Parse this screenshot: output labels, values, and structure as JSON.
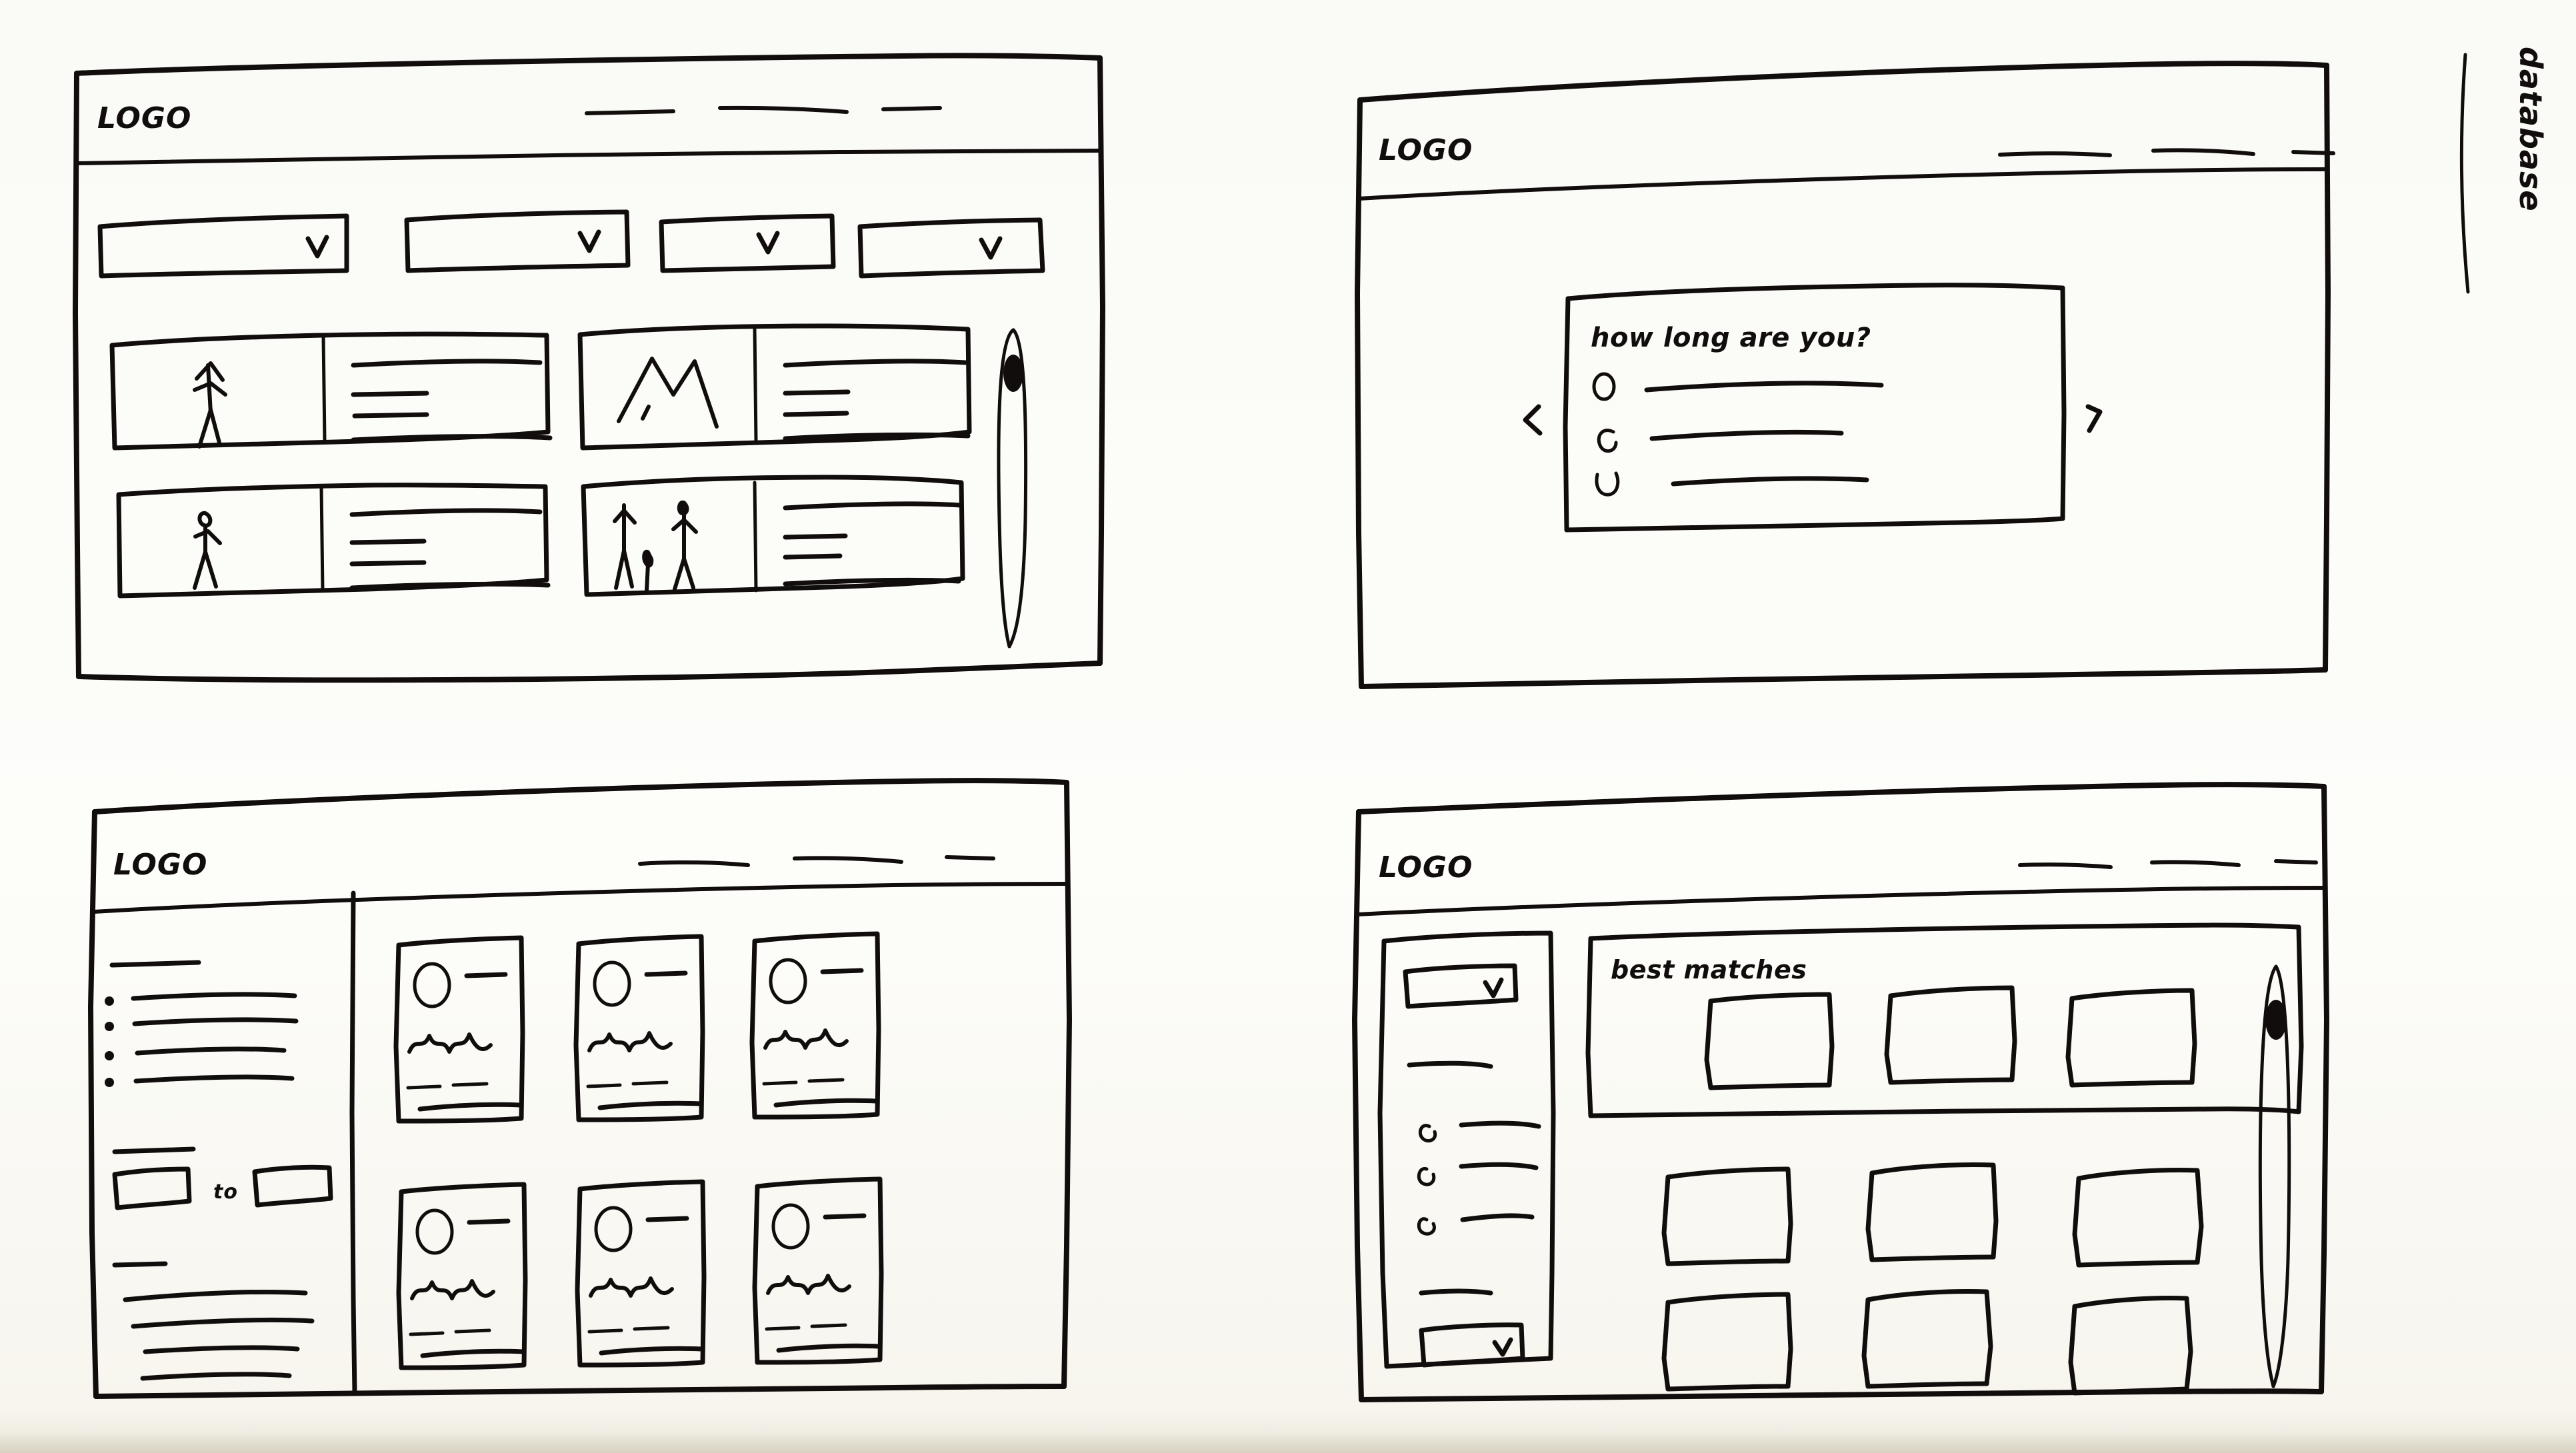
{
  "sketch": {
    "medium": "hand-drawn marker wireframe on paper",
    "ink_color": "#100d0c",
    "paper_color": "#fdfdfb",
    "panel_count": 4
  },
  "annotation": {
    "label": "database",
    "orientation": "vertical",
    "underlined": true
  },
  "panel_browse": {
    "name": "browse-results-screen",
    "logo": "LOGO",
    "nav_links": [
      "—",
      "——",
      "——"
    ],
    "filters": [
      {
        "label": "",
        "chevron": "v"
      },
      {
        "label": "",
        "chevron": "v"
      },
      {
        "label": "",
        "chevron": "v"
      },
      {
        "label": "",
        "chevron": "v"
      }
    ],
    "cards": [
      {
        "thumb": "single-standing-figure",
        "lines": 4
      },
      {
        "thumb": "mountain-peaks",
        "lines": 4
      },
      {
        "thumb": "single-walking-figure",
        "lines": 4
      },
      {
        "thumb": "group-of-figures",
        "lines": 4
      }
    ],
    "scrollbar": {
      "thumb_position": "top"
    }
  },
  "panel_question": {
    "name": "question-modal-screen",
    "logo": "LOGO",
    "nav_links": [
      "——",
      "——",
      "——"
    ],
    "dialog": {
      "question": "how long are you?",
      "options": [
        {
          "control": "radio",
          "answer": "————————"
        },
        {
          "control": "radio",
          "answer": "——————"
        },
        {
          "control": "radio",
          "answer": "———————"
        }
      ]
    },
    "prev_arrow": "<",
    "next_arrow": ">"
  },
  "panel_filtered": {
    "name": "filtered-grid-screen",
    "logo": "LOGO",
    "nav_links": [
      "——",
      "——",
      "——"
    ],
    "sidebar": {
      "section_label": "——",
      "checkbox_items": [
        "————————",
        "————————",
        "———————",
        "————————"
      ],
      "range_label": "———",
      "range": {
        "from": "",
        "to_label": "to",
        "to": ""
      },
      "second_label": "——",
      "text_lines": [
        "—————————",
        "—————————",
        "————————",
        "———————"
      ]
    },
    "results": {
      "columns": 3,
      "rows": 2,
      "card": {
        "avatar": "circle",
        "name_line": "—",
        "squiggle": "text",
        "tags": [
          "—",
          "—"
        ],
        "footer_line": "————————"
      }
    }
  },
  "panel_matches": {
    "name": "best-matches-screen",
    "logo": "LOGO",
    "nav_links": [
      "——",
      "——",
      "——"
    ],
    "sidebar": {
      "top_dropdown": {
        "label": "",
        "chevron": "v"
      },
      "group_label": "————",
      "radio_items": [
        "——————",
        "—————",
        "—————"
      ],
      "bottom_label": "————",
      "bottom_dropdown": {
        "label": "",
        "chevron": "v"
      }
    },
    "best_matches": {
      "heading": "best matches",
      "card_count": 3
    },
    "grid": {
      "columns": 3,
      "rows": 2,
      "card_count": 6
    },
    "scrollbar": {
      "thumb_position": "top"
    }
  }
}
